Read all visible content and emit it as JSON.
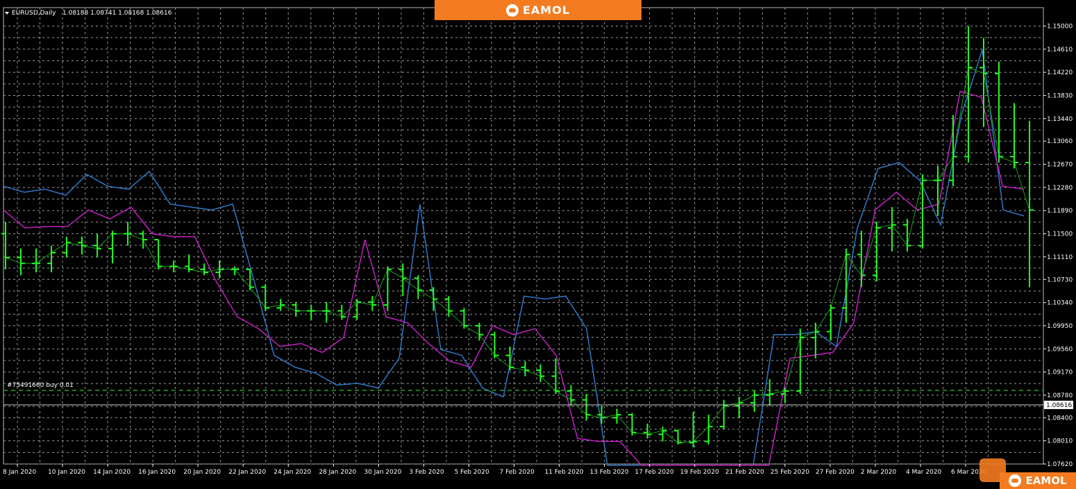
{
  "header": {
    "symbol": "EURUSD,Daily",
    "values": "1.08188 1.08741 1.08168 1.08616"
  },
  "brand": {
    "name": "EAMOL"
  },
  "order_label": "#75491660 buy 0.01",
  "current_price": "1.08616",
  "colors": {
    "background": "#000000",
    "grid": "#9a9a9a",
    "bars": "#22ff22",
    "outer_band": "#2f78c8",
    "mid_band": "#c41fc4",
    "yellow_line": "#c8b820",
    "teal_band": "#2a8a88",
    "green_line": "#1aa01a",
    "order_line": "#22aa22",
    "brand": "#f47b20"
  },
  "chart_data": {
    "type": "ohlc",
    "title": "EURUSD,Daily",
    "y_ticks": [
      "1.15000",
      "1.14610",
      "1.14220",
      "1.13830",
      "1.13440",
      "1.13060",
      "1.12670",
      "1.12280",
      "1.11890",
      "1.11500",
      "1.11110",
      "1.10730",
      "1.10340",
      "1.09950",
      "1.09560",
      "1.09170",
      "1.08780",
      "1.08400",
      "1.08010",
      "1.07620"
    ],
    "x_ticks": [
      "8 Jan 2020",
      "10 Jan 2020",
      "14 Jan 2020",
      "16 Jan 2020",
      "20 Jan 2020",
      "22 Jan 2020",
      "24 Jan 2020",
      "28 Jan 2020",
      "30 Jan 2020",
      "3 Feb 2020",
      "5 Feb 2020",
      "7 Feb 2020",
      "11 Feb 2020",
      "13 Feb 2020",
      "17 Feb 2020",
      "19 Feb 2020",
      "21 Feb 2020",
      "25 Feb 2020",
      "27 Feb 2020",
      "2 Mar 2020",
      "4 Mar 2020",
      "6 Mar 2020"
    ],
    "ylim": [
      1.0762,
      1.1531
    ],
    "order_price": 1.0886,
    "current_price": 1.08616,
    "bars": [
      {
        "o": 1.115,
        "h": 1.117,
        "l": 1.109,
        "c": 1.111
      },
      {
        "o": 1.111,
        "h": 1.1125,
        "l": 1.108,
        "c": 1.11
      },
      {
        "o": 1.11,
        "h": 1.1125,
        "l": 1.1085,
        "c": 1.11
      },
      {
        "o": 1.11,
        "h": 1.113,
        "l": 1.1085,
        "c": 1.1118
      },
      {
        "o": 1.1118,
        "h": 1.1145,
        "l": 1.111,
        "c": 1.1135
      },
      {
        "o": 1.1135,
        "h": 1.1145,
        "l": 1.1115,
        "c": 1.113
      },
      {
        "o": 1.113,
        "h": 1.115,
        "l": 1.111,
        "c": 1.1125
      },
      {
        "o": 1.1125,
        "h": 1.1155,
        "l": 1.11,
        "c": 1.115
      },
      {
        "o": 1.115,
        "h": 1.117,
        "l": 1.113,
        "c": 1.115
      },
      {
        "o": 1.115,
        "h": 1.1155,
        "l": 1.1125,
        "c": 1.114
      },
      {
        "o": 1.114,
        "h": 1.114,
        "l": 1.109,
        "c": 1.1095
      },
      {
        "o": 1.1095,
        "h": 1.1105,
        "l": 1.1085,
        "c": 1.1095
      },
      {
        "o": 1.1095,
        "h": 1.1115,
        "l": 1.1085,
        "c": 1.109
      },
      {
        "o": 1.109,
        "h": 1.11,
        "l": 1.108,
        "c": 1.1085
      },
      {
        "o": 1.1085,
        "h": 1.1105,
        "l": 1.1075,
        "c": 1.109
      },
      {
        "o": 1.109,
        "h": 1.1095,
        "l": 1.108,
        "c": 1.109
      },
      {
        "o": 1.109,
        "h": 1.109,
        "l": 1.1055,
        "c": 1.106
      },
      {
        "o": 1.106,
        "h": 1.1065,
        "l": 1.102,
        "c": 1.1025
      },
      {
        "o": 1.1025,
        "h": 1.104,
        "l": 1.102,
        "c": 1.103
      },
      {
        "o": 1.103,
        "h": 1.1035,
        "l": 1.101,
        "c": 1.102
      },
      {
        "o": 1.102,
        "h": 1.103,
        "l": 1.1005,
        "c": 1.102
      },
      {
        "o": 1.102,
        "h": 1.1035,
        "l": 1.1,
        "c": 1.102
      },
      {
        "o": 1.102,
        "h": 1.103,
        "l": 1.1005,
        "c": 1.101
      },
      {
        "o": 1.101,
        "h": 1.104,
        "l": 1.1005,
        "c": 1.1035
      },
      {
        "o": 1.1035,
        "h": 1.1045,
        "l": 1.102,
        "c": 1.103
      },
      {
        "o": 1.103,
        "h": 1.1095,
        "l": 1.102,
        "c": 1.109
      },
      {
        "o": 1.109,
        "h": 1.11,
        "l": 1.1045,
        "c": 1.1075
      },
      {
        "o": 1.1075,
        "h": 1.108,
        "l": 1.104,
        "c": 1.1055
      },
      {
        "o": 1.1055,
        "h": 1.106,
        "l": 1.102,
        "c": 1.104
      },
      {
        "o": 1.104,
        "h": 1.1045,
        "l": 1.101,
        "c": 1.102
      },
      {
        "o": 1.102,
        "h": 1.1025,
        "l": 1.099,
        "c": 1.0995
      },
      {
        "o": 1.0995,
        "h": 1.1,
        "l": 1.097,
        "c": 1.098
      },
      {
        "o": 1.098,
        "h": 1.0985,
        "l": 1.094,
        "c": 1.0945
      },
      {
        "o": 1.0945,
        "h": 1.096,
        "l": 1.092,
        "c": 1.0925
      },
      {
        "o": 1.0925,
        "h": 1.0935,
        "l": 1.091,
        "c": 1.092
      },
      {
        "o": 1.092,
        "h": 1.093,
        "l": 1.09,
        "c": 1.091
      },
      {
        "o": 1.091,
        "h": 1.094,
        "l": 1.088,
        "c": 1.0885
      },
      {
        "o": 1.0885,
        "h": 1.0895,
        "l": 1.086,
        "c": 1.087
      },
      {
        "o": 1.087,
        "h": 1.088,
        "l": 1.0835,
        "c": 1.0845
      },
      {
        "o": 1.0845,
        "h": 1.086,
        "l": 1.083,
        "c": 1.084
      },
      {
        "o": 1.084,
        "h": 1.0855,
        "l": 1.083,
        "c": 1.0845
      },
      {
        "o": 1.0845,
        "h": 1.0848,
        "l": 1.081,
        "c": 1.0815
      },
      {
        "o": 1.0815,
        "h": 1.083,
        "l": 1.0805,
        "c": 1.0812
      },
      {
        "o": 1.0812,
        "h": 1.0825,
        "l": 1.08,
        "c": 1.0818
      },
      {
        "o": 1.0818,
        "h": 1.082,
        "l": 1.0795,
        "c": 1.0798
      },
      {
        "o": 1.0798,
        "h": 1.085,
        "l": 1.079,
        "c": 1.08
      },
      {
        "o": 1.08,
        "h": 1.0845,
        "l": 1.0795,
        "c": 1.0825
      },
      {
        "o": 1.0825,
        "h": 1.087,
        "l": 1.082,
        "c": 1.086
      },
      {
        "o": 1.086,
        "h": 1.0875,
        "l": 1.084,
        "c": 1.0865
      },
      {
        "o": 1.0865,
        "h": 1.0885,
        "l": 1.085,
        "c": 1.0878
      },
      {
        "o": 1.0878,
        "h": 1.0905,
        "l": 1.086,
        "c": 1.088
      },
      {
        "o": 1.088,
        "h": 1.089,
        "l": 1.0865,
        "c": 1.0885
      },
      {
        "o": 1.0885,
        "h": 1.099,
        "l": 1.088,
        "c": 1.0975
      },
      {
        "o": 1.0975,
        "h": 1.1,
        "l": 1.094,
        "c": 1.0985
      },
      {
        "o": 1.0985,
        "h": 1.103,
        "l": 1.097,
        "c": 1.1025
      },
      {
        "o": 1.1025,
        "h": 1.1125,
        "l": 1.1,
        "c": 1.1115
      },
      {
        "o": 1.1115,
        "h": 1.1155,
        "l": 1.106,
        "c": 1.108
      },
      {
        "o": 1.108,
        "h": 1.117,
        "l": 1.107,
        "c": 1.116
      },
      {
        "o": 1.116,
        "h": 1.1195,
        "l": 1.112,
        "c": 1.1165
      },
      {
        "o": 1.1165,
        "h": 1.1175,
        "l": 1.112,
        "c": 1.113
      },
      {
        "o": 1.113,
        "h": 1.125,
        "l": 1.1125,
        "c": 1.124
      },
      {
        "o": 1.124,
        "h": 1.1265,
        "l": 1.118,
        "c": 1.124
      },
      {
        "o": 1.124,
        "h": 1.135,
        "l": 1.123,
        "c": 1.128
      },
      {
        "o": 1.128,
        "h": 1.15,
        "l": 1.127,
        "c": 1.143
      },
      {
        "o": 1.143,
        "h": 1.148,
        "l": 1.133,
        "c": 1.142
      },
      {
        "o": 1.142,
        "h": 1.144,
        "l": 1.127,
        "c": 1.128
      },
      {
        "o": 1.128,
        "h": 1.137,
        "l": 1.126,
        "c": 1.127
      },
      {
        "o": 1.127,
        "h": 1.134,
        "l": 1.106,
        "c": 1.119
      }
    ],
    "series": [
      {
        "values": [
          1.123,
          1.122,
          1.1225,
          1.1215,
          1.125,
          1.123,
          1.1225,
          1.1255,
          1.12,
          1.1195,
          1.119,
          1.12,
          1.1075,
          1.0945,
          1.0925,
          1.0915,
          1.0895,
          1.0898,
          1.089,
          1.094,
          1.12,
          1.0955,
          1.0945,
          1.089,
          1.0875,
          1.1045,
          1.104,
          1.1045,
          1.099,
          1.076,
          1.076,
          1.076,
          1.076,
          1.076,
          1.076,
          1.076,
          1.076,
          1.098,
          1.098,
          1.0985,
          1.096,
          1.116,
          1.126,
          1.127,
          1.124,
          1.1165,
          1.135,
          1.146,
          1.119,
          1.118
        ]
      },
      {
        "values": [
          1.119,
          1.116,
          1.1162,
          1.1162,
          1.119,
          1.1175,
          1.1195,
          1.115,
          1.1145,
          1.1145,
          1.107,
          1.101,
          1.099,
          1.096,
          1.0965,
          1.095,
          1.0975,
          1.114,
          1.101,
          1.1,
          1.0965,
          1.0935,
          1.0925,
          1.0995,
          1.098,
          1.099,
          1.0945,
          1.0805,
          1.08,
          1.08,
          1.076,
          1.076,
          1.076,
          1.076,
          1.076,
          1.076,
          1.076,
          1.094,
          1.0945,
          1.095,
          1.1,
          1.119,
          1.122,
          1.119,
          1.12,
          1.139,
          1.138,
          1.123,
          1.1225
        ]
      }
    ]
  }
}
